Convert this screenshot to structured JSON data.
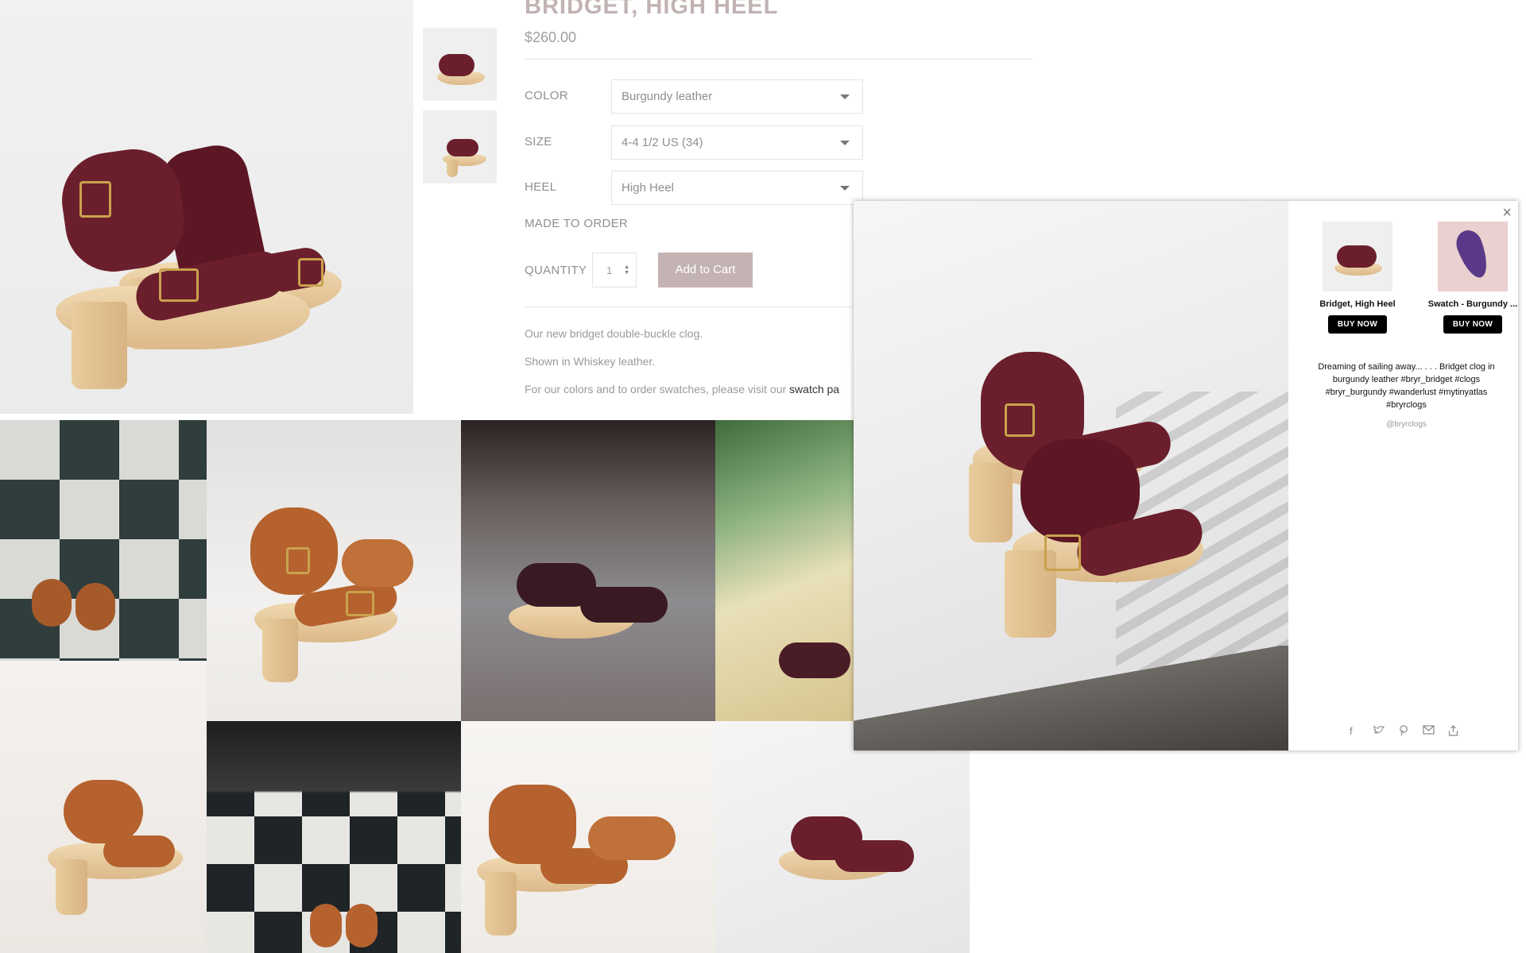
{
  "product": {
    "title": "BRIDGET, HIGH HEEL",
    "price": "$260.00"
  },
  "options": {
    "color": {
      "label": "COLOR",
      "value": "Burgundy leather"
    },
    "size": {
      "label": "SIZE",
      "value": "4-4 1/2 US (34)"
    },
    "heel": {
      "label": "HEEL",
      "value": "High Heel"
    }
  },
  "made_to_order": "MADE TO ORDER",
  "quantity": {
    "label": "QUANTITY",
    "value": "1"
  },
  "cart_button": "Add to Cart",
  "description": {
    "line1": "Our new bridget double-buckle clog.",
    "line2": "Shown in Whiskey leather.",
    "line3_prefix": "For our colors and to order swatches, please visit our ",
    "line3_link": "swatch pa"
  },
  "modal": {
    "close": "×",
    "products": [
      {
        "name": "Bridget, High Heel",
        "button": "BUY NOW"
      },
      {
        "name": "Swatch - Burgundy ...",
        "button": "BUY NOW"
      }
    ],
    "caption": "Dreaming of sailing away... . . . Bridget clog in burgundy leather #bryr_bridget #clogs #bryr_burgundy #wanderlust #mytinyatlas #bryrclogs",
    "handle": "@bryrclogs",
    "share_icons": [
      "facebook-icon",
      "twitter-icon",
      "pinterest-icon",
      "email-icon",
      "share-icon"
    ]
  },
  "colors": {
    "burgundy": "#6b1f2c",
    "whiskey": "#b5622e",
    "accent_button": "#c4b3b3",
    "title": "#c2b3b3"
  }
}
